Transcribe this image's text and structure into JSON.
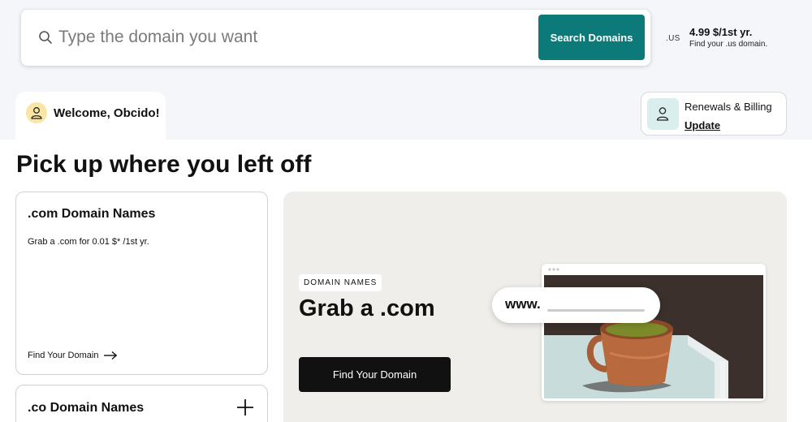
{
  "search": {
    "placeholder": "Type the domain you want",
    "button_label": "Search Domains"
  },
  "tld_promo": {
    "tld": ".US",
    "price": "4.99 $/1st yr.",
    "description": "Find your .us domain."
  },
  "welcome": {
    "text": "Welcome, Obcido!"
  },
  "billing": {
    "title": "Renewals & Billing",
    "link_label": "Update"
  },
  "section": {
    "title": "Pick up where you left off"
  },
  "domain_cards": [
    {
      "title": ".com Domain Names",
      "description": "Grab a .com for 0.01 $* /1st yr.",
      "link_label": "Find Your Domain"
    },
    {
      "title": ".co Domain Names"
    }
  ],
  "promo": {
    "badge": "DOMAIN NAMES",
    "title": "Grab a .com",
    "button_label": "Find Your Domain",
    "url_prefix": "www."
  },
  "colors": {
    "accent": "#0c7a78",
    "avatar_bg": "#f9e6a4",
    "billing_icon_bg": "#d9eeed",
    "promo_bg": "#efeeea"
  },
  "icons": {
    "search": "search-icon",
    "user": "user-icon",
    "arrow": "arrow-right-icon",
    "plus": "plus-icon"
  }
}
